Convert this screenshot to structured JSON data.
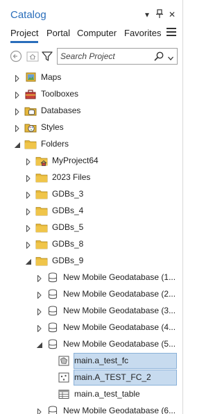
{
  "pane": {
    "title": "Catalog",
    "buttons": {
      "options": "▾",
      "pin": "⭥",
      "close": "✕"
    }
  },
  "tabs": [
    {
      "label": "Project",
      "active": true
    },
    {
      "label": "Portal",
      "active": false
    },
    {
      "label": "Computer",
      "active": false
    },
    {
      "label": "Favorites",
      "active": false
    }
  ],
  "toolbar": {
    "search_placeholder": "Search Project"
  },
  "tree": [
    {
      "label": "Maps",
      "icon": "maps-icon",
      "expander": "collapsed"
    },
    {
      "label": "Toolboxes",
      "icon": "toolbox-icon",
      "expander": "collapsed"
    },
    {
      "label": "Databases",
      "icon": "database-folder-icon",
      "expander": "collapsed"
    },
    {
      "label": "Styles",
      "icon": "styles-icon",
      "expander": "collapsed"
    },
    {
      "label": "Folders",
      "icon": "folder-icon",
      "expander": "expanded"
    },
    {
      "label": "MyProject64",
      "icon": "home-folder-icon",
      "expander": "collapsed"
    },
    {
      "label": "2023 Files",
      "icon": "folder-icon",
      "expander": "collapsed"
    },
    {
      "label": "GDBs_3",
      "icon": "folder-icon",
      "expander": "collapsed"
    },
    {
      "label": "GDBs_4",
      "icon": "folder-icon",
      "expander": "collapsed"
    },
    {
      "label": "GDBs_5",
      "icon": "folder-icon",
      "expander": "collapsed"
    },
    {
      "label": "GDBs_8",
      "icon": "folder-icon",
      "expander": "collapsed"
    },
    {
      "label": "GDBs_9",
      "icon": "folder-icon",
      "expander": "expanded"
    },
    {
      "label": "New Mobile Geodatabase (1...",
      "icon": "geodatabase-icon",
      "expander": "collapsed"
    },
    {
      "label": "New Mobile Geodatabase (2...",
      "icon": "geodatabase-icon",
      "expander": "collapsed"
    },
    {
      "label": "New Mobile Geodatabase (3...",
      "icon": "geodatabase-icon",
      "expander": "collapsed"
    },
    {
      "label": "New Mobile Geodatabase (4...",
      "icon": "geodatabase-icon",
      "expander": "collapsed"
    },
    {
      "label": "New Mobile Geodatabase (5...",
      "icon": "geodatabase-icon",
      "expander": "expanded"
    },
    {
      "label": "main.a_test_fc",
      "icon": "polygon-feature-class-icon",
      "expander": "none",
      "selected": true
    },
    {
      "label": "main.A_TEST_FC_2",
      "icon": "point-feature-class-icon",
      "expander": "none",
      "selected": true
    },
    {
      "label": "main.a_test_table",
      "icon": "table-icon",
      "expander": "none"
    },
    {
      "label": "New Mobile Geodatabase (6...",
      "icon": "geodatabase-icon",
      "expander": "collapsed"
    }
  ],
  "colors": {
    "accent": "#2a6ebb",
    "selection": "#c7dbef",
    "folder": "#e5b73b"
  }
}
